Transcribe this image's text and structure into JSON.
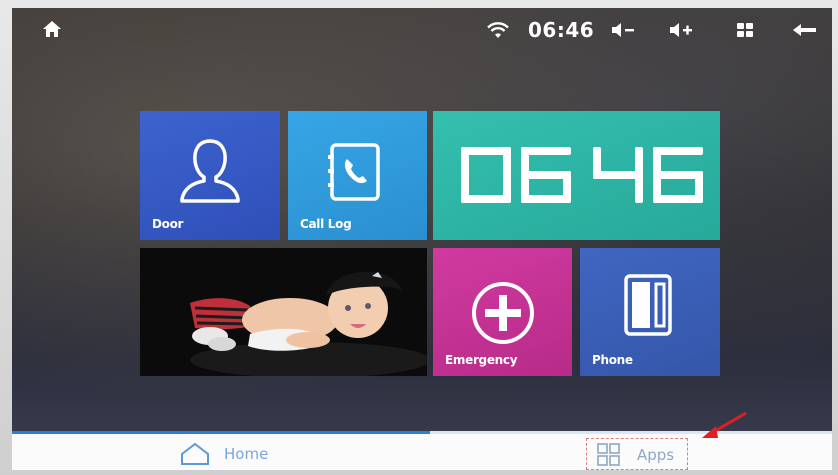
{
  "status_bar": {
    "time": "06:46",
    "icons": [
      "home-icon",
      "wifi-icon",
      "volume-down-icon",
      "volume-up-icon",
      "grid-icon",
      "back-icon"
    ]
  },
  "tiles": {
    "door": {
      "label": "Door",
      "icon": "person-icon",
      "color": "#3559c4"
    },
    "call_log": {
      "label": "Call Log",
      "icon": "phone-book-icon",
      "color": "#2f9ad9"
    },
    "clock": {
      "hours": "06",
      "minutes": "46",
      "color": "#2fb5a5"
    },
    "photo": {
      "icon": "photo-frame"
    },
    "emergency": {
      "label": "Emergency",
      "icon": "plus-circle-icon",
      "color": "#c3318f"
    },
    "phone": {
      "label": "Phone",
      "icon": "intercom-handset-icon",
      "color": "#3a5db4"
    }
  },
  "nav_bar": {
    "home_label": "Home",
    "apps_label": "Apps",
    "accent": "#2b7fd4"
  }
}
